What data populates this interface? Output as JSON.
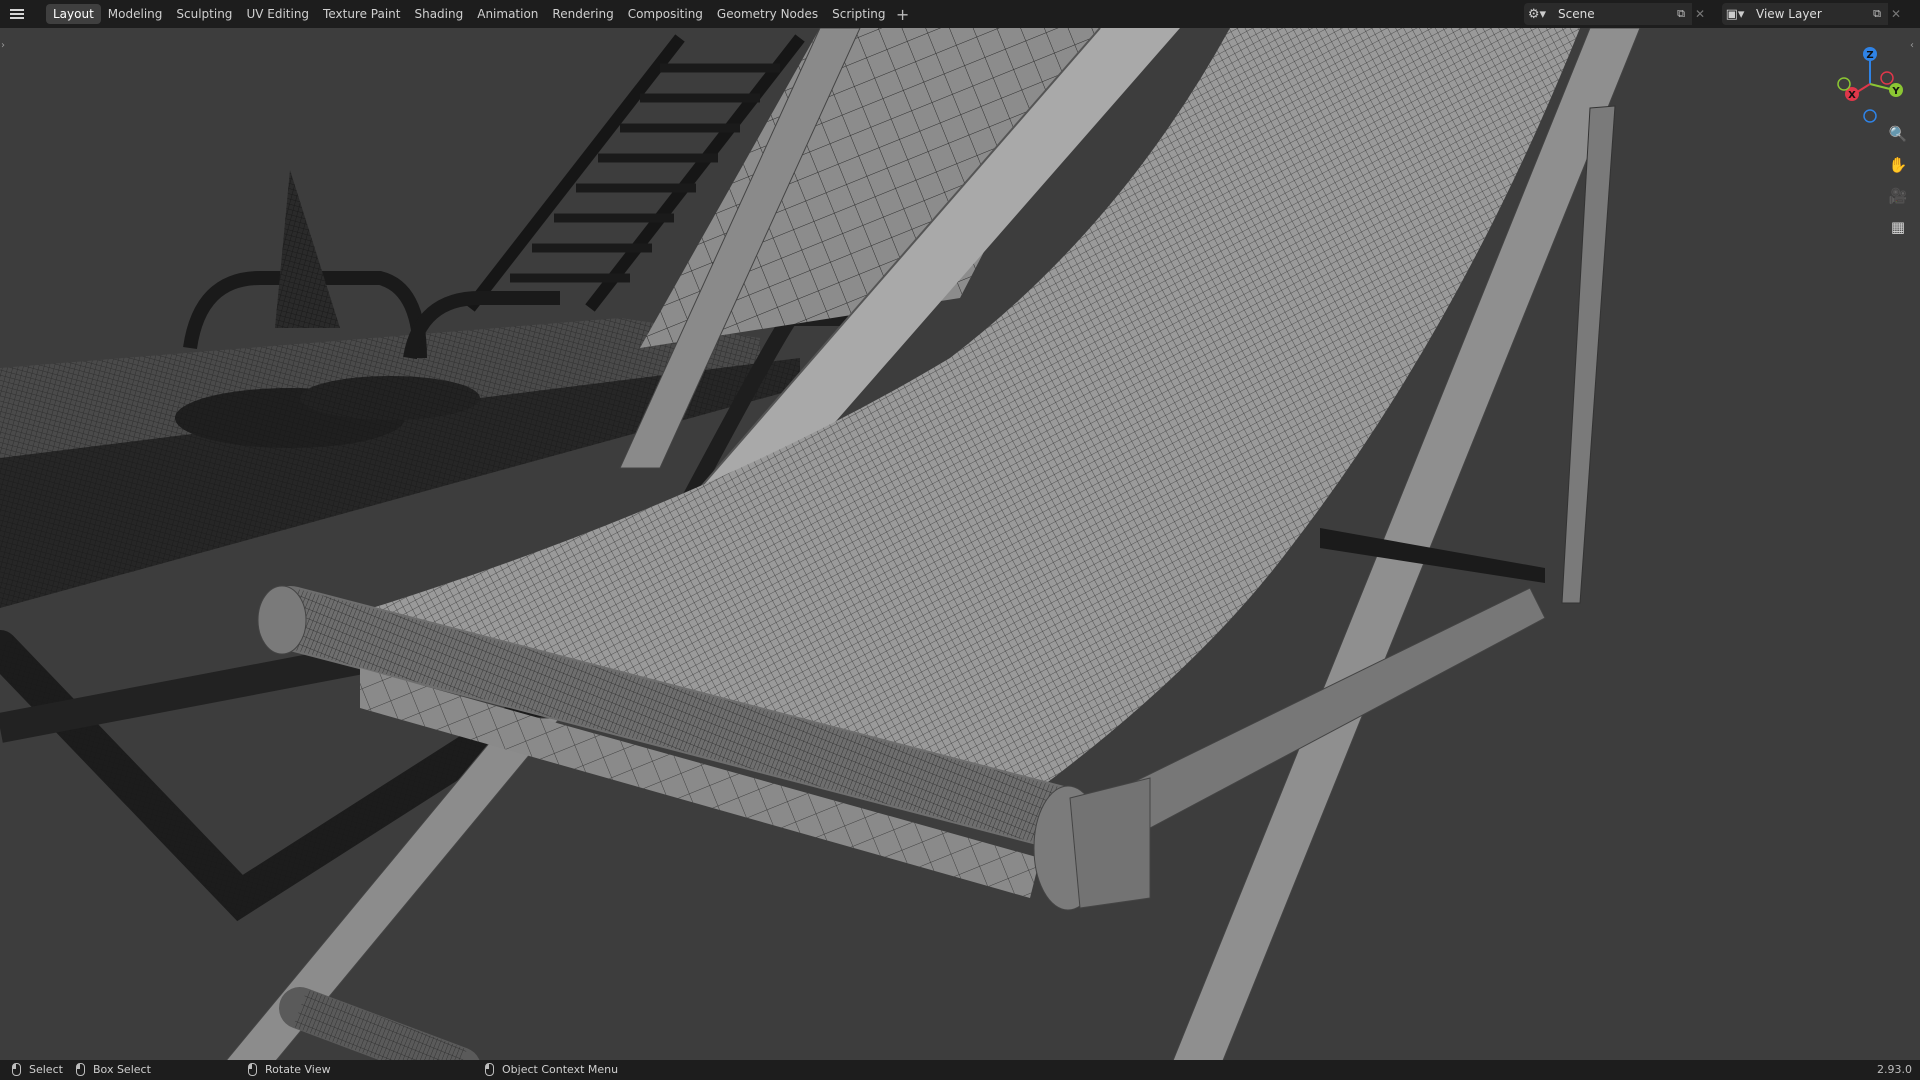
{
  "topbar": {
    "tabs": [
      {
        "label": "Layout",
        "active": true
      },
      {
        "label": "Modeling"
      },
      {
        "label": "Sculpting"
      },
      {
        "label": "UV Editing"
      },
      {
        "label": "Texture Paint"
      },
      {
        "label": "Shading"
      },
      {
        "label": "Animation"
      },
      {
        "label": "Rendering"
      },
      {
        "label": "Compositing"
      },
      {
        "label": "Geometry Nodes"
      },
      {
        "label": "Scripting"
      }
    ],
    "add_tab": "+",
    "scene_name": "Scene",
    "view_layer_name": "View Layer"
  },
  "gizmo": {
    "x_label": "X",
    "y_label": "Y",
    "z_label": "Z",
    "x_color": "#e0374a",
    "y_color": "#8bc633",
    "z_color": "#2f83e6"
  },
  "nav_tools": [
    "zoom-icon",
    "pan-hand-icon",
    "camera-icon",
    "ortho-grid-icon"
  ],
  "statusbar": {
    "select": "Select",
    "box_select": "Box Select",
    "rotate_view": "Rotate View",
    "context_menu": "Object Context Menu",
    "version": "2.93.0"
  },
  "colors": {
    "viewport_bg": "#3d3d3d",
    "header_bg": "#1d1d1d",
    "active_tab": "#3f3f3f"
  }
}
